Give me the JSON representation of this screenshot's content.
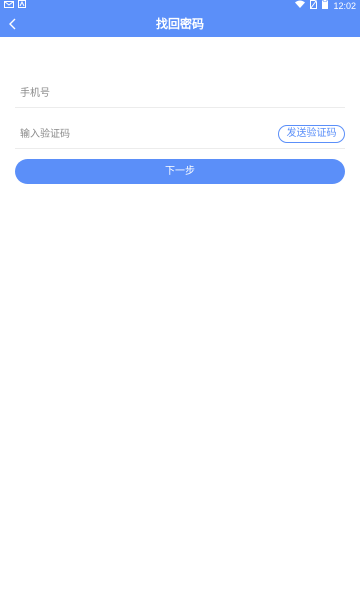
{
  "status_bar": {
    "time": "12:02",
    "left_icons": [
      "mail-icon",
      "android-notification-icon"
    ],
    "right_icons": [
      "wifi-icon",
      "no-sim-icon",
      "battery-icon"
    ]
  },
  "header": {
    "title": "找回密码",
    "back_icon": "chevron-left-icon",
    "background_color": "#5b8ff9"
  },
  "form": {
    "phone": {
      "value": "",
      "placeholder": "手机号"
    },
    "code": {
      "value": "",
      "placeholder": "输入验证码"
    },
    "send_code_label": "发送验证码"
  },
  "next_button": {
    "label": "下一步"
  },
  "colors": {
    "accent": "#5b8ff9",
    "placeholder": "#8a8a8a",
    "divider": "#ececec"
  }
}
